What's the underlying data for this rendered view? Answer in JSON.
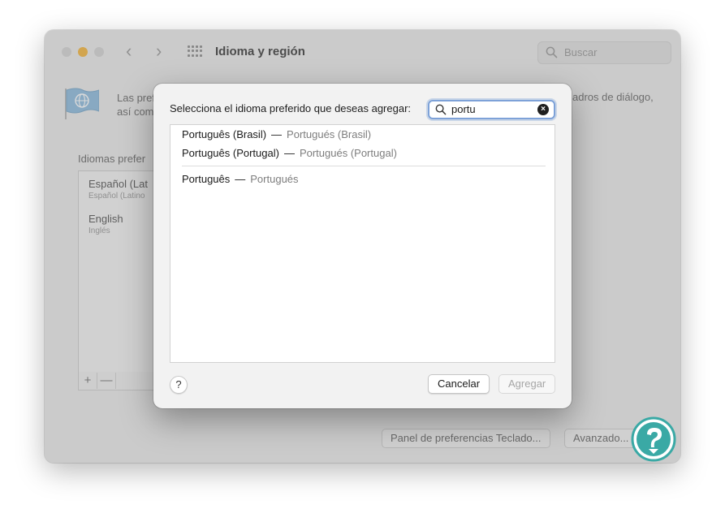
{
  "window": {
    "title": "Idioma y región",
    "search_placeholder": "Buscar",
    "desc_line1": "Las pref",
    "desc_line2": "así com",
    "desc_right": "adros de diálogo,",
    "languages_heading": "Idiomas prefer",
    "languages": [
      {
        "name": "Español (Lat",
        "sub": "Español (Latino"
      },
      {
        "name": "English",
        "sub": "Inglés"
      }
    ],
    "add_label": "+",
    "remove_label": "—",
    "keyboard_prefs_label": "Panel de preferencias Teclado...",
    "advanced_label": "Avanzado..."
  },
  "sheet": {
    "prompt": "Selecciona el idioma preferido que deseas agregar:",
    "search_value": "portu",
    "clear_symbol": "×",
    "results_group1": [
      {
        "native": "Português (Brasil)",
        "dash": "—",
        "translation": "Portugués (Brasil)"
      },
      {
        "native": "Português (Portugal)",
        "dash": "—",
        "translation": "Portugués (Portugal)"
      }
    ],
    "results_group2": [
      {
        "native": "Português",
        "dash": "—",
        "translation": "Portugués"
      }
    ],
    "help_label": "?",
    "cancel_label": "Cancelar",
    "add_label": "Agregar"
  },
  "colors": {
    "accent": "#7ea2d8",
    "minimize": "#f5b840",
    "watermark": "#3aa9a5"
  },
  "icons": [
    "search-icon",
    "grid-icon",
    "globe-flag-icon",
    "clear-icon",
    "help-icon",
    "watermark-logo"
  ]
}
